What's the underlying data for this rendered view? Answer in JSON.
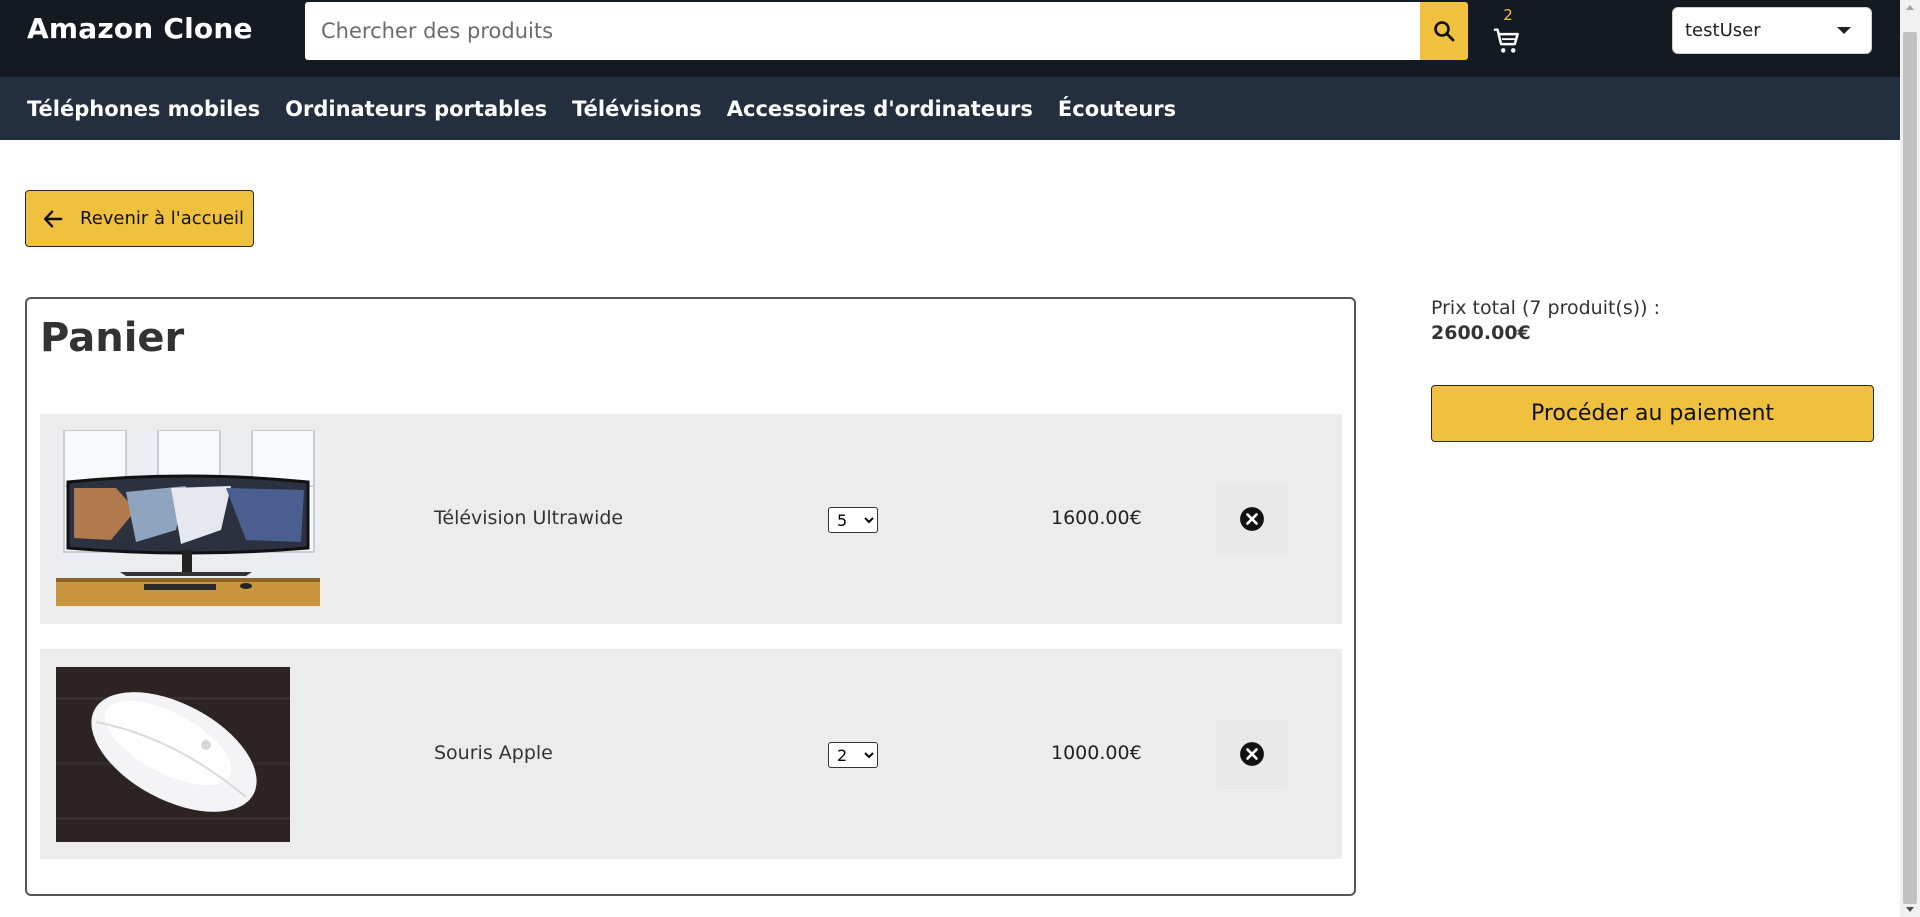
{
  "header": {
    "brand": "Amazon Clone",
    "search_placeholder": "Chercher des produits",
    "cart_count": "2",
    "user": "testUser"
  },
  "nav": {
    "categories": [
      "Téléphones mobiles",
      "Ordinateurs portables",
      "Télévisions",
      "Accessoires d'ordinateurs",
      "Écouteurs"
    ]
  },
  "back_label": "Revenir à l'accueil",
  "cart": {
    "title": "Panier",
    "items": [
      {
        "name": "Télévision Ultrawide",
        "quantity": "5",
        "price": "1600.00€"
      },
      {
        "name": "Souris Apple",
        "quantity": "2",
        "price": "1000.00€"
      }
    ]
  },
  "summary": {
    "total_label": "Prix total (7 produit(s)) :",
    "total_value": "2600.00€",
    "pay_label": "Procéder au paiement"
  },
  "colors": {
    "header_bg": "#131a22",
    "nav_bg": "#232f3e",
    "accent": "#f0c03f",
    "row_bg": "#ececec"
  }
}
